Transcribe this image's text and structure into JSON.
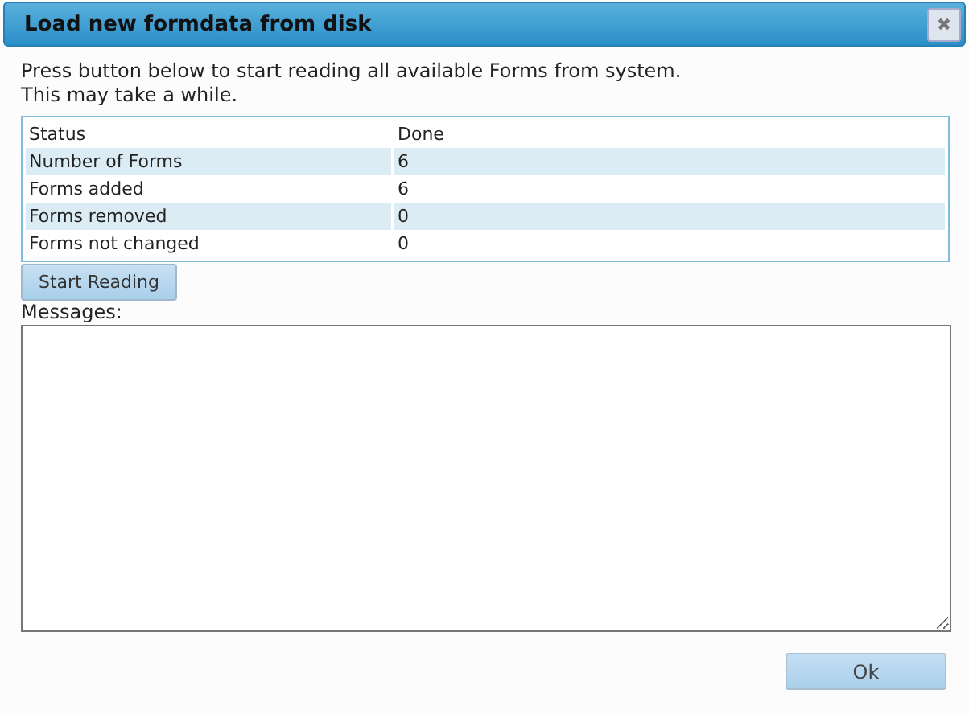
{
  "window": {
    "title": "Load new formdata from disk",
    "close": "✖"
  },
  "intro": [
    "Press button below to start reading all available Forms from system.",
    "This may take a while."
  ],
  "table": {
    "rows": [
      {
        "label": "Status",
        "value": "Done"
      },
      {
        "label": "Number of Forms",
        "value": "6"
      },
      {
        "label": "Forms added",
        "value": "6"
      },
      {
        "label": "Forms removed",
        "value": "0"
      },
      {
        "label": "Forms not changed",
        "value": "0"
      }
    ]
  },
  "start_button": "Start Reading",
  "messages": {
    "label": "Messages:"
  },
  "ok_button": "Ok"
}
